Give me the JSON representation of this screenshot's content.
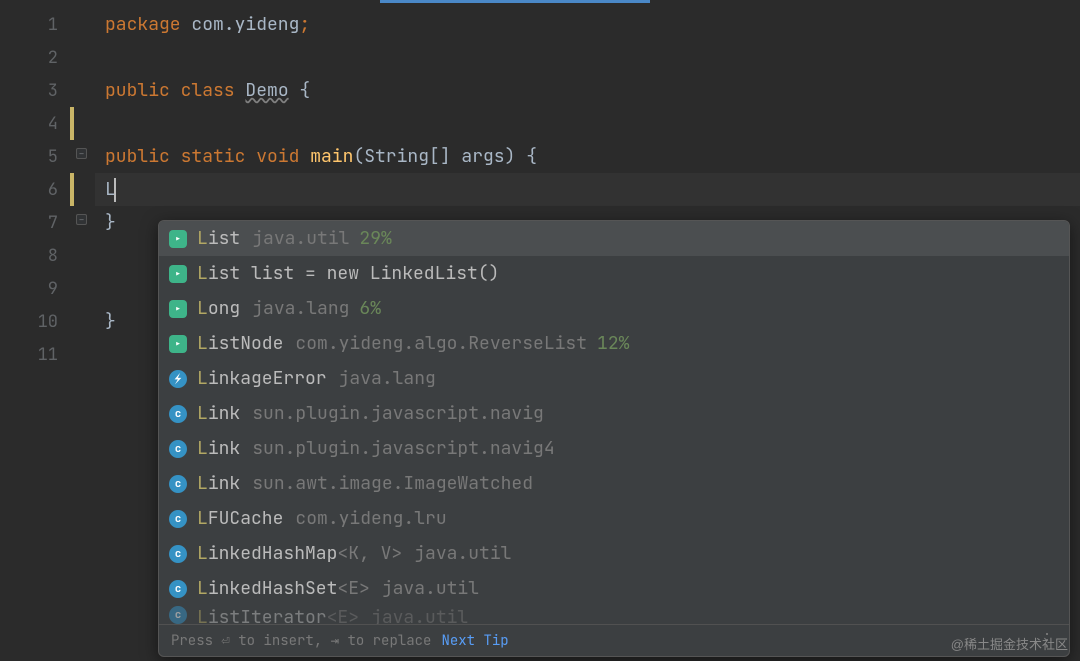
{
  "lines": {
    "numbers": [
      "1",
      "2",
      "3",
      "4",
      "5",
      "6",
      "7",
      "8",
      "9",
      "10",
      "11"
    ]
  },
  "code": {
    "line1_package": "package",
    "line1_pkg": " com.yideng",
    "line1_semi": ";",
    "line3_public": "public",
    "line3_class": " class ",
    "line3_name": "Demo",
    "line3_brace": " {",
    "line5_modifiers": "public static ",
    "line5_void": "void ",
    "line5_main": "main",
    "line5_params": "(String[] args)",
    "line5_brace": " {",
    "line6_typed": "L",
    "line7_brace": "}",
    "line10_brace": "}"
  },
  "completions": [
    {
      "icon": "arrow",
      "hl": "L",
      "text": "ist",
      "pkg": "java.util",
      "pct": "29%"
    },
    {
      "icon": "arrow",
      "hl": "L",
      "text": "ist list = new LinkedList()",
      "pkg": "",
      "pct": ""
    },
    {
      "icon": "arrow",
      "hl": "L",
      "text": "ong",
      "pkg": "java.lang",
      "pct": "6%"
    },
    {
      "icon": "arrow",
      "hl": "L",
      "text": "istNode",
      "pkg": "com.yideng.algo.ReverseList",
      "pct": "12%"
    },
    {
      "icon": "bolt",
      "hl": "L",
      "text": "inkageError",
      "pkg": "java.lang",
      "pct": ""
    },
    {
      "icon": "c",
      "hl": "L",
      "text": "ink",
      "pkg": "sun.plugin.javascript.navig",
      "pct": ""
    },
    {
      "icon": "c",
      "hl": "L",
      "text": "ink",
      "pkg": "sun.plugin.javascript.navig4",
      "pct": ""
    },
    {
      "icon": "c",
      "hl": "L",
      "text": "ink",
      "pkg": "sun.awt.image.ImageWatched",
      "pct": ""
    },
    {
      "icon": "c",
      "hl": "L",
      "text": "FUCache",
      "pkg": "com.yideng.lru",
      "pct": ""
    },
    {
      "icon": "c",
      "hl": "L",
      "text": "inkedHashMap",
      "generic": "<K, V>",
      "pkg": "java.util",
      "pct": ""
    },
    {
      "icon": "c",
      "hl": "L",
      "text": "inkedHashSet",
      "generic": "<E>",
      "pkg": "java.util",
      "pct": ""
    },
    {
      "icon": "c",
      "hl": "L",
      "text": "istIterator",
      "generic": "<E>",
      "pkg": "java.util",
      "pct": "",
      "cutoff": true
    }
  ],
  "footer": {
    "hint": "Press ⏎ to insert, ⇥ to replace",
    "nextTip": "Next Tip"
  },
  "watermark": "@稀土掘金技术社区"
}
